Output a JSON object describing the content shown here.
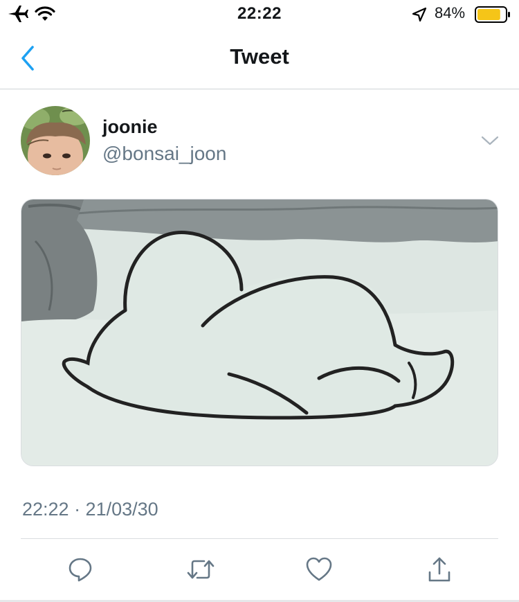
{
  "status_bar": {
    "time": "22:22",
    "battery_percent": "84%",
    "battery_level": 0.84,
    "battery_color": "#f5c518",
    "icons": [
      "airplane-icon",
      "wifi-icon",
      "location-arrow-icon",
      "battery-icon"
    ]
  },
  "nav": {
    "title": "Tweet",
    "back_icon": "chevron-left-icon",
    "accent_color": "#1da1f2"
  },
  "tweet": {
    "author": {
      "display_name": "joonie",
      "handle": "@bonsai_joon"
    },
    "more_icon": "chevron-down-icon",
    "media": "cartoon-image",
    "timestamp": "22:22 · 21/03/30"
  },
  "actions": [
    {
      "name": "reply-button",
      "icon": "reply-icon"
    },
    {
      "name": "retweet-button",
      "icon": "retweet-icon"
    },
    {
      "name": "like-button",
      "icon": "heart-icon"
    },
    {
      "name": "share-button",
      "icon": "share-icon"
    }
  ],
  "colors": {
    "text_primary": "#14171a",
    "text_secondary": "#657786",
    "divider": "#d9dcdf"
  }
}
